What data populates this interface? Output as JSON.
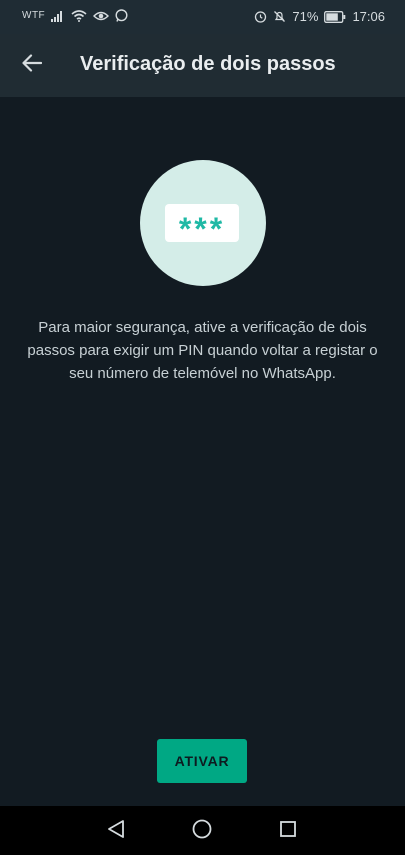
{
  "status_bar": {
    "carrier": "WTF",
    "battery_percent": "71%",
    "time": "17:06",
    "icons": [
      "signal-icon",
      "wifi-icon",
      "eye-icon",
      "whatsapp-icon",
      "alarm-icon",
      "mute-icon",
      "battery-icon"
    ]
  },
  "app_bar": {
    "title": "Verificação de dois passos",
    "back_icon": "arrow-left-icon"
  },
  "illustration": {
    "pin_mask": "***"
  },
  "description": "Para maior segurança, ative a verificação de dois passos para exigir um PIN quando voltar a registar o seu número de telemóvel no WhatsApp.",
  "activate_button": {
    "label": "ATIVAR"
  },
  "nav_bar": {
    "icons": [
      "triangle-back-icon",
      "circle-home-icon",
      "square-recent-icon"
    ]
  },
  "colors": {
    "background": "#121b22",
    "app_bar": "#202c33",
    "accent": "#00a884",
    "pin_color": "#1fb9a5",
    "illustration_bg": "#d4ede8"
  }
}
